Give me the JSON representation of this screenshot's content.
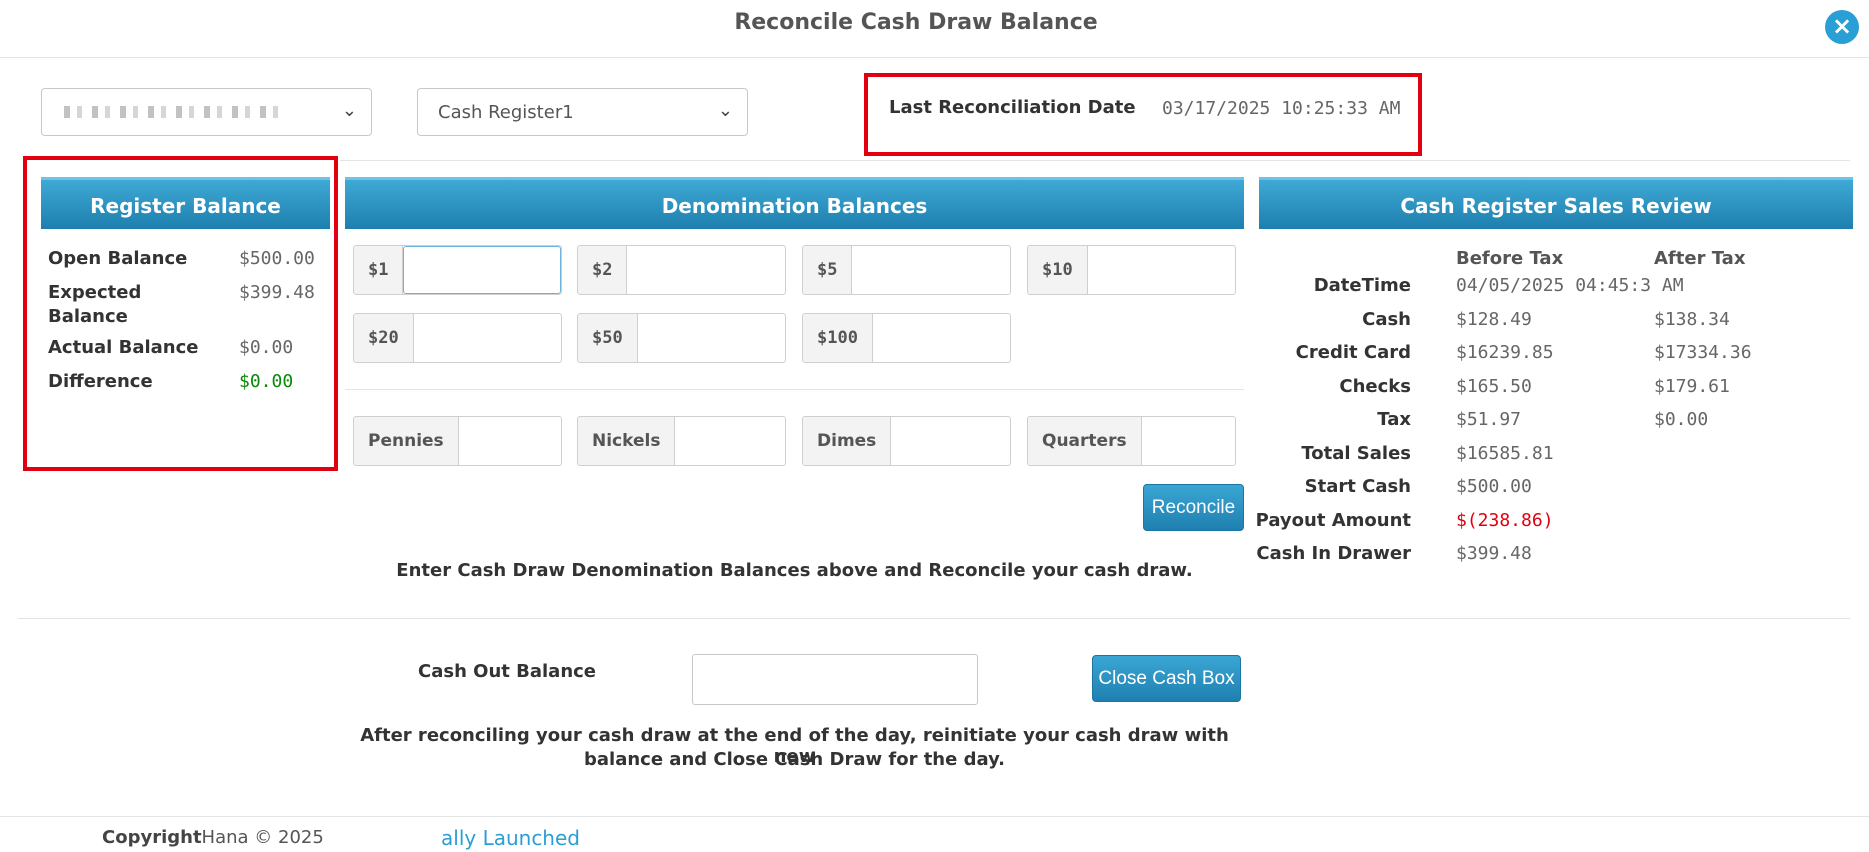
{
  "dialog": {
    "title": "Reconcile Cash Draw Balance",
    "close_icon": "×"
  },
  "selectors": {
    "store_value": "",
    "register_value": "Cash Register1",
    "chevron": "⌄"
  },
  "last_reconciliation": {
    "label": "Last Reconciliation Date",
    "value": "03/17/2025 10:25:33 AM"
  },
  "register_balance": {
    "heading": "Register Balance",
    "rows": [
      {
        "label": "Open Balance",
        "value": "$500.00"
      },
      {
        "label": "Expected Balance",
        "value": "$399.48"
      },
      {
        "label": "Actual Balance",
        "value": "$0.00"
      },
      {
        "label": "Difference",
        "value": "$0.00"
      }
    ]
  },
  "denominations": {
    "heading": "Denomination Balances",
    "bills": [
      "$1",
      "$2",
      "$5",
      "$10",
      "$20",
      "$50",
      "$100"
    ],
    "coins": [
      "Pennies",
      "Nickels",
      "Dimes",
      "Quarters"
    ],
    "reconcile_label": "Reconcile",
    "instruction": "Enter Cash Draw Denomination Balances above and Reconcile your cash draw."
  },
  "sales_review": {
    "heading": "Cash Register Sales Review",
    "col_before": "Before Tax",
    "col_after": "After Tax",
    "rows": [
      {
        "label": "DateTime",
        "before": "04/05/2025 04:45:3 AM",
        "after": ""
      },
      {
        "label": "Cash",
        "before": "$128.49",
        "after": "$138.34"
      },
      {
        "label": "Credit Card",
        "before": "$16239.85",
        "after": "$17334.36"
      },
      {
        "label": "Checks",
        "before": "$165.50",
        "after": "$179.61"
      },
      {
        "label": "Tax",
        "before": "$51.97",
        "after": "$0.00"
      },
      {
        "label": "Total Sales",
        "before": "$16585.81",
        "after": ""
      },
      {
        "label": "Start Cash",
        "before": "$500.00",
        "after": ""
      },
      {
        "label": "Payout Amount",
        "before": "$(238.86)",
        "after": ""
      },
      {
        "label": "Cash In Drawer",
        "before": "$399.48",
        "after": ""
      }
    ]
  },
  "cash_out": {
    "label": "Cash Out Balance",
    "value": "",
    "close_label": "Close Cash Box",
    "instruction_line1": "After reconciling your cash draw at the end of the day, reinitiate your cash draw with new",
    "instruction_line2": "balance and Close Cash Draw for the day."
  },
  "footer": {
    "copyright_bold": "Copyright",
    "copyright_rest": "Hana © 2025",
    "link": "ally Launched"
  },
  "colors": {
    "accent": "#2a9fd6",
    "highlight_red": "#e0000f",
    "difference_green": "#0a8a0a"
  }
}
